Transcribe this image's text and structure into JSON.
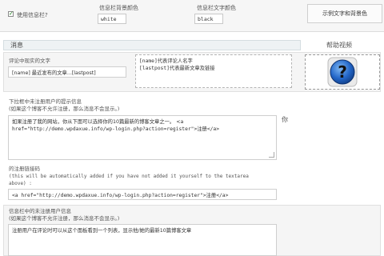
{
  "top": {
    "use_infobar_label": "使用信息栏?",
    "bg_color_label": "信息栏背景颜色",
    "bg_color_value": "white",
    "text_color_label": "信息栏文字颜色",
    "text_color_value": "black",
    "sample_button": "示例文字和背景色"
  },
  "message_section": {
    "title": "消息",
    "help_video_label": "帮助视频",
    "existing_users_label": "评论中现实的文字",
    "existing_users_value": "[name] 最近发布的文章...[lastpost]",
    "hint_line1": "[name]代表评论人名字",
    "hint_line2": "[lastpost]代表最新文章及链接"
  },
  "dropdown_section": {
    "label_line1": "下拉框中未注册用户的提示信息",
    "label_line2": "(如果这个博客不允许注册，那么消息不会显示。)",
    "value_line1": "如果注册了我的网站，你从下面可以选择你的10篇最新的博客文章之一。 <a",
    "value_line2": "href=\"http://demo.wpdaxue.info/wp-login.php?action=register\">注册</a>",
    "side_text": "你"
  },
  "register_link": {
    "label": "的注册链接码",
    "note_line1": "(this will be automatically added if you have not added it yourself to the textarea",
    "note_line2": "above) :",
    "value": "<a href=\"http://demo.wpdaxue.info/wp-login.php?action=register\">注册</a>"
  },
  "infobar_section": {
    "label_line1": "信息栏中的未注册用户信息",
    "label_line2": "(如果这个博客不允许注册，那么消息不会显示。)",
    "value": "注册用户在评论时可以从这个面板看到一个列表，显示他/她的最新10篇博客文章"
  }
}
